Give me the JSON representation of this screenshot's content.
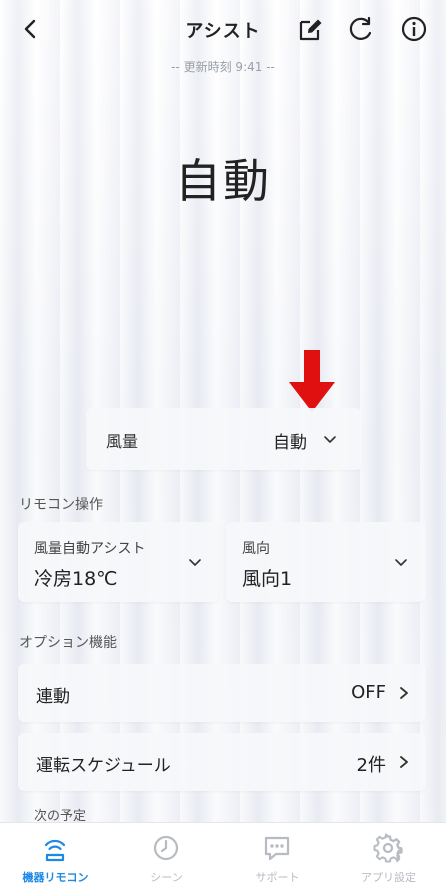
{
  "header": {
    "title": "アシスト",
    "updated": "-- 更新時刻 9:41 --"
  },
  "mode": {
    "current": "自動"
  },
  "fan_speed": {
    "label": "風量",
    "value": "自動"
  },
  "remote_section": {
    "title": "リモコン操作",
    "cards": [
      {
        "label": "風量自動アシスト",
        "value": "冷房18℃"
      },
      {
        "label": "風向",
        "value": "風向1"
      }
    ]
  },
  "option_section": {
    "title": "オプション機能",
    "rows": [
      {
        "label": "連動",
        "value": "OFF"
      },
      {
        "label": "運転スケジュール",
        "value": "2件"
      }
    ],
    "next_label": "次の予定"
  },
  "tabs": [
    {
      "label": "機器リモコン",
      "active": true,
      "icon": "remote-icon"
    },
    {
      "label": "シーン",
      "active": false,
      "icon": "clock-icon"
    },
    {
      "label": "サポート",
      "active": false,
      "icon": "chat-icon"
    },
    {
      "label": "アプリ設定",
      "active": false,
      "icon": "gear-icon"
    }
  ],
  "colors": {
    "accent": "#1e88e5",
    "arrow": "#e01010",
    "tab_inactive": "#b7bbc2"
  }
}
